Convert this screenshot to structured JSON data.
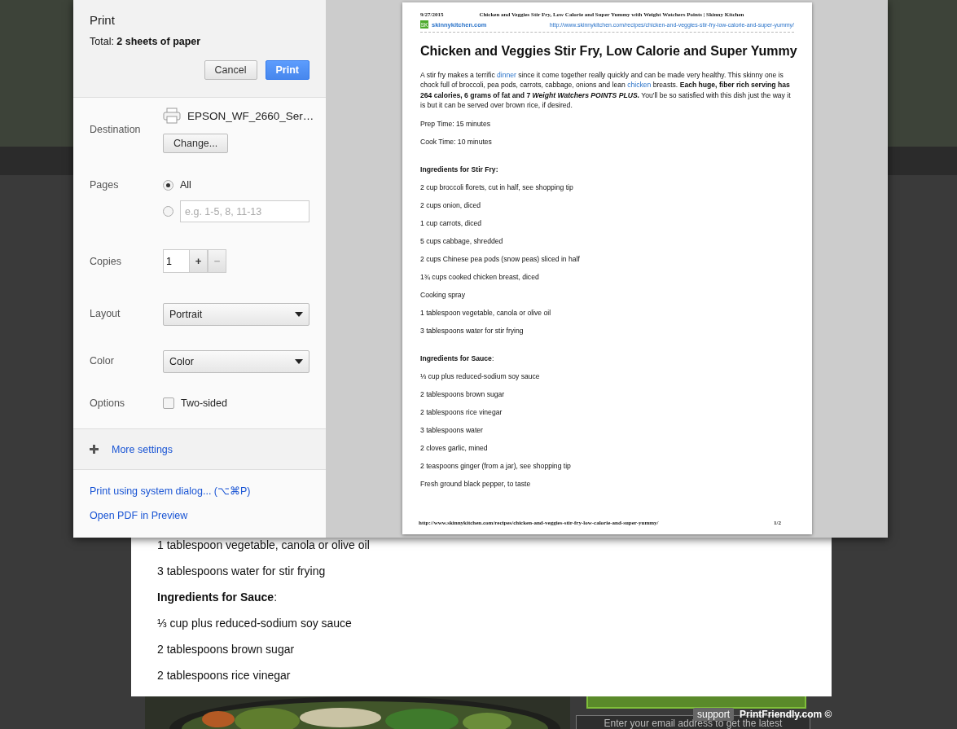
{
  "background_page": {
    "sheet_lines": [
      {
        "kind": "line",
        "text": "1 tablespoon vegetable, canola or olive oil"
      },
      {
        "kind": "line",
        "text": "3 tablespoons water for stir frying"
      },
      {
        "kind": "heading",
        "text": "**Ingredients for Sauce**:"
      },
      {
        "kind": "line",
        "text": "⅓ cup plus reduced-sodium soy sauce"
      },
      {
        "kind": "line",
        "text": "2 tablespoons brown sugar"
      },
      {
        "kind": "line",
        "text": "2 tablespoons rice vinegar"
      }
    ],
    "email_field": {
      "placeholder": "Enter your email address to get the latest"
    },
    "support_badge": "support",
    "footer_brand": "PrintFriendly.com ©"
  },
  "print_dialog": {
    "title": "Print",
    "total": "Total: **2 sheets of paper**",
    "buttons": [
      {
        "label": "Cancel",
        "kind": "default"
      },
      {
        "label": "Print",
        "kind": "primary"
      }
    ],
    "destination": {
      "label": "Destination",
      "printer": "EPSON_WF_2660_Ser…",
      "change_button": "Change..."
    },
    "pages": {
      "label": "Pages",
      "options": [
        {
          "kind": "label",
          "label": "All",
          "selected": true
        },
        {
          "kind": "range",
          "placeholder": "e.g. 1-5, 8, 11-13",
          "selected": false
        }
      ]
    },
    "copies": {
      "label": "Copies",
      "value": "1",
      "steppers": [
        {
          "label": "+",
          "disabled": false
        },
        {
          "label": "−",
          "disabled": true
        }
      ]
    },
    "layout": {
      "label": "Layout",
      "value": "Portrait"
    },
    "color": {
      "label": "Color",
      "value": "Color"
    },
    "options": {
      "label": "Options",
      "checkbox": {
        "label": "Two-sided",
        "checked": false
      }
    },
    "more_settings": "More settings",
    "links": [
      "Print using system dialog... (⌥⌘P)",
      "Open PDF in Preview"
    ]
  },
  "preview": {
    "date": "9/27/2015",
    "page_title": "Chicken and Veggies Stir Fry, Low Calorie and Super Yummy with Weight Watchers Points | Skinny Kitchen",
    "logo": "SK",
    "site": "skinnykitchen.com",
    "url": "http://www.skinnykitchen.com/recipes/chicken-and-veggies-stir-fry-low-calorie-and-super-yummy/",
    "heading": "Chicken and Veggies Stir Fry, Low Calorie and Super Yummy",
    "intro": [
      {
        "kind": "text",
        "text": "A stir fry makes a terrific "
      },
      {
        "kind": "link",
        "text": "dinner"
      },
      {
        "kind": "text",
        "text": " since it come together really quickly and can be made very healthy.  This skinny one is chock full of broccoli, pea pods, carrots, cabbage, onions and lean "
      },
      {
        "kind": "link",
        "text": "chicken"
      },
      {
        "kind": "text",
        "text": " breasts. "
      },
      {
        "kind": "bold",
        "text": "Each huge, fiber rich serving has 264 calories, 6 grams of fat and 7 "
      },
      {
        "kind": "bolditalic",
        "text": "Weight Watchers POINTS PLUS."
      },
      {
        "kind": "text",
        "text": "  You'll be so satisfied with this dish just the way it is but it can be served over brown rice, if desired."
      }
    ],
    "lines": [
      {
        "kind": "line",
        "text": "Prep Time: 15 minutes"
      },
      {
        "kind": "line",
        "text": "Cook Time: 10 minutes"
      },
      {
        "kind": "heading",
        "text": "**Ingredients for Stir Fry:**"
      },
      {
        "kind": "line",
        "text": "2 cup broccoli florets, cut in half, see shopping tip"
      },
      {
        "kind": "line",
        "text": "2 cups onion, diced"
      },
      {
        "kind": "line",
        "text": "1 cup carrots, diced"
      },
      {
        "kind": "line",
        "text": "5 cups cabbage, shredded"
      },
      {
        "kind": "line",
        "text": "2 cups Chinese pea pods (snow peas) sliced in half"
      },
      {
        "kind": "line",
        "text": "1¾ cups cooked chicken breast, diced"
      },
      {
        "kind": "line",
        "text": "Cooking spray"
      },
      {
        "kind": "line",
        "text": "1 tablespoon vegetable, canola or olive oil"
      },
      {
        "kind": "line",
        "text": "3 tablespoons water for stir frying"
      },
      {
        "kind": "heading",
        "text": "**Ingredients for Sauce**:"
      },
      {
        "kind": "line",
        "text": "⅓ cup plus reduced-sodium soy sauce"
      },
      {
        "kind": "line",
        "text": "2 tablespoons brown sugar"
      },
      {
        "kind": "line",
        "text": "2 tablespoons rice vinegar"
      },
      {
        "kind": "line",
        "text": "3 tablespoons water"
      },
      {
        "kind": "line",
        "text": "2 cloves garlic, mined"
      },
      {
        "kind": "line",
        "text": "2 teaspoons ginger (from a jar), see shopping tip"
      },
      {
        "kind": "line",
        "text": "Fresh ground black pepper, to taste"
      }
    ],
    "footer_url": "http://www.skinnykitchen.com/recipes/chicken-and-veggies-stir-fry-low-calorie-and-super-yummy/",
    "page_number": "1/2"
  }
}
